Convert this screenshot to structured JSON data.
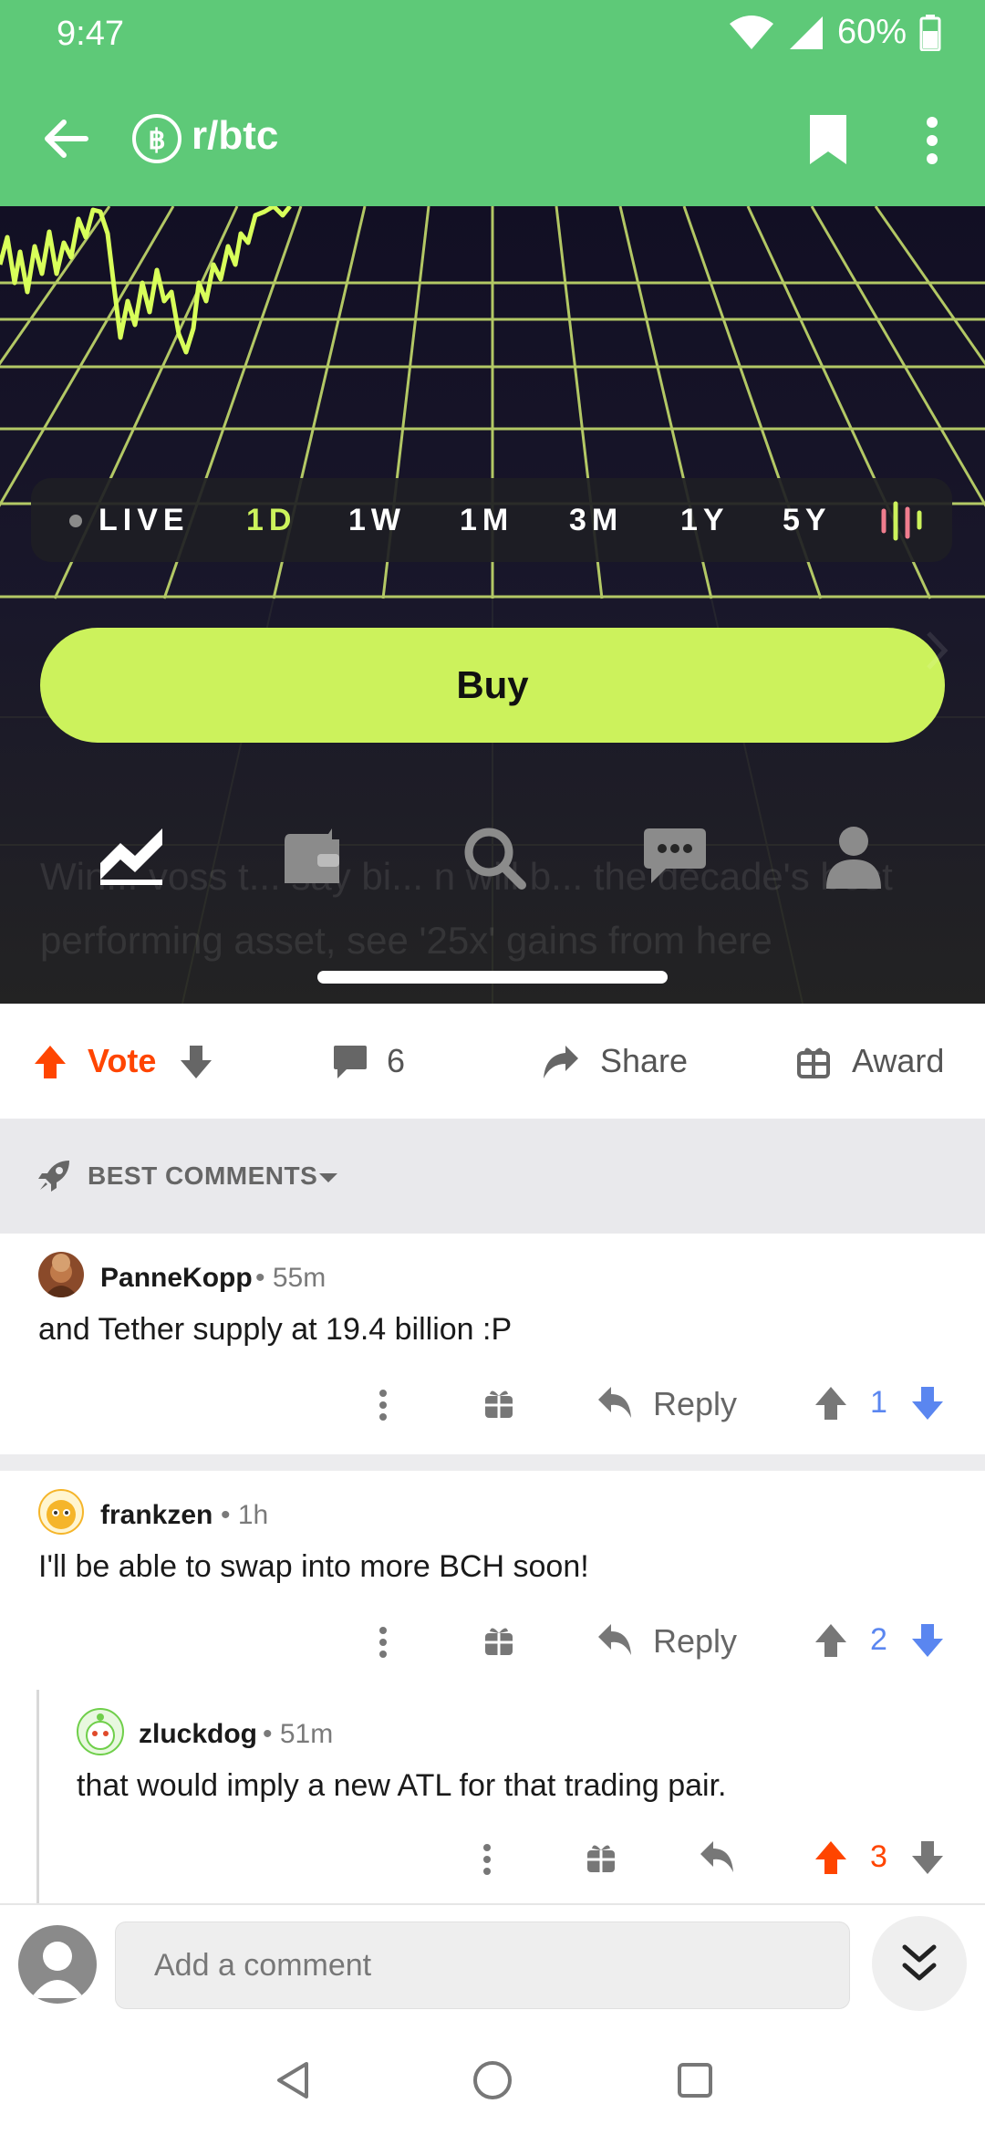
{
  "status_bar": {
    "time": "9:47",
    "battery": "60%"
  },
  "app_bar": {
    "subreddit": "r/btc",
    "icons": [
      "back-arrow-icon",
      "bitcoin-icon",
      "bookmark-icon",
      "more-vertical-icon"
    ]
  },
  "media": {
    "time_ranges": [
      "LIVE",
      "1D",
      "1W",
      "1M",
      "3M",
      "1Y",
      "5Y"
    ],
    "selected_range": "1D",
    "buy_label": "Buy",
    "faded_caption": "Win... voss t... say bi... n will b... the decade's best performing asset, see '25x' gains from here",
    "accent_color": "#ccf25c",
    "tab_icons": [
      "chart-icon",
      "wallet-icon",
      "search-icon",
      "chat-icon",
      "profile-icon"
    ]
  },
  "actions": {
    "vote_label": "Vote",
    "comment_count": "6",
    "share_label": "Share",
    "award_label": "Award"
  },
  "sort": {
    "label": "BEST COMMENTS"
  },
  "comments": [
    {
      "author": "PanneKopp",
      "time": "55m",
      "body": "and Tether supply at 19.4 billion :P",
      "reply_label": "Reply",
      "score": "1"
    },
    {
      "author": "frankzen",
      "time": "1h",
      "body": "I'll be able to swap into more BCH soon!",
      "reply_label": "Reply",
      "score": "2"
    },
    {
      "author": "zluckdog",
      "time": "51m",
      "body": "that would imply a new ATL for that trading pair.",
      "score": "3"
    }
  ],
  "compose": {
    "placeholder": "Add a comment"
  },
  "colors": {
    "header_green": "#5ec978",
    "upvote_orange": "#ff4500",
    "downvote_blue": "#5a86f0"
  }
}
